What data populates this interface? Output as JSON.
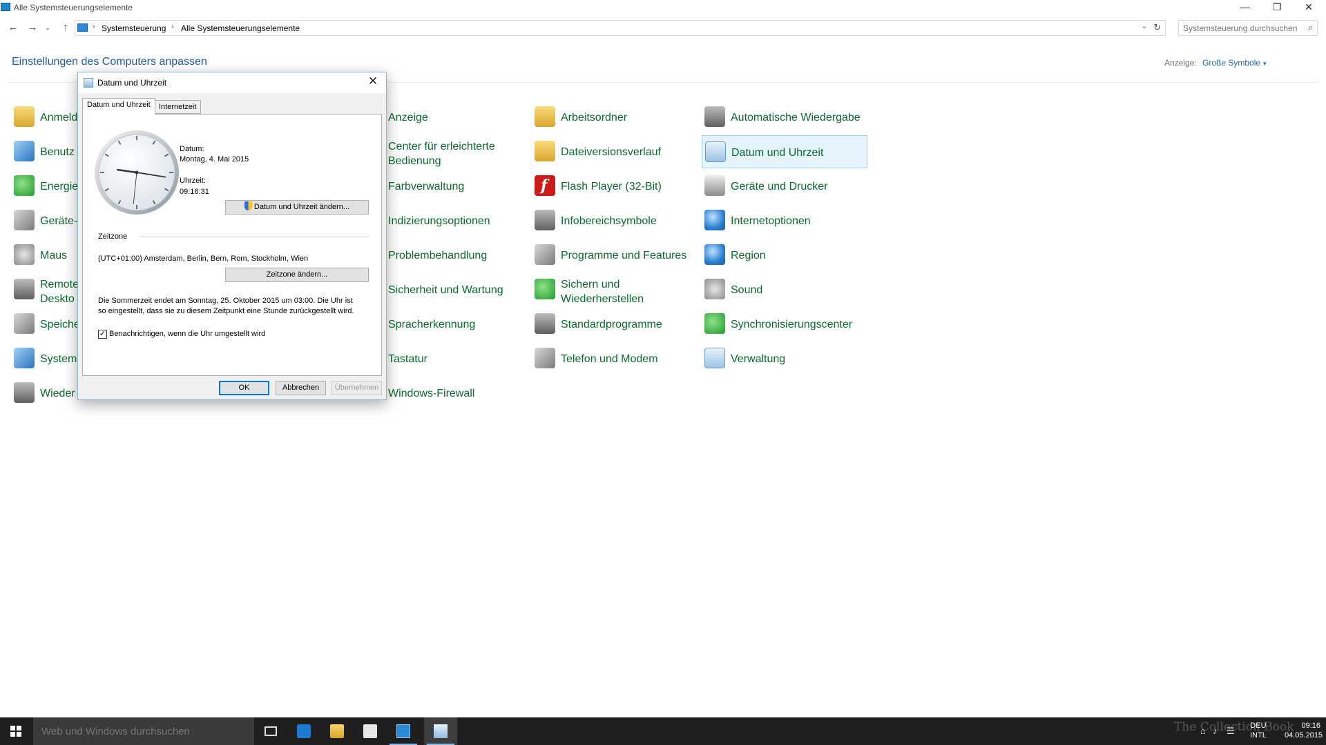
{
  "window": {
    "title": "Alle Systemsteuerungselemente",
    "min_icon": "—",
    "max_icon": "❐",
    "close_icon": "✕"
  },
  "nav": {
    "back_icon": "←",
    "forward_icon": "→",
    "recent_icon": "⌄",
    "up_icon": "↑",
    "breadcrumb_sep": "›",
    "breadcrumb": [
      "Systemsteuerung",
      "Alle Systemsteuerungselemente"
    ],
    "dropdown_icon": "⌄",
    "refresh_icon": "↻",
    "search_placeholder": "Systemsteuerung durchsuchen",
    "search_icon": "⌕"
  },
  "header": {
    "title": "Einstellungen des Computers anpassen",
    "view_label": "Anzeige:",
    "view_value": "Große Symbole",
    "view_caret": "▾"
  },
  "items": {
    "col1": [
      "Anmeld",
      "Benutz",
      "Energie",
      "Geräte-",
      "Maus",
      "Remote Deskto",
      "Speiche",
      "System",
      "Wieder"
    ],
    "col2": [
      "Anzeige",
      "Center für erleichterte Bedienung",
      "Farbverwaltung",
      "Indizierungsoptionen",
      "Problembehandlung",
      "Sicherheit und Wartung",
      "Spracherkennung",
      "Tastatur",
      "Windows-Firewall"
    ],
    "col3": [
      "Arbeitsordner",
      "Dateiversionsverlauf",
      "Flash Player (32-Bit)",
      "Infobereichsymbole",
      "Programme und Features",
      "Sichern und Wiederherstellen",
      "Standardprogramme",
      "Telefon und Modem"
    ],
    "col4": [
      "Automatische Wiedergabe",
      "Datum und Uhrzeit",
      "Geräte und Drucker",
      "Internetoptionen",
      "Region",
      "Sound",
      "Synchronisierungscenter",
      "Verwaltung"
    ]
  },
  "dialog": {
    "title": "Datum und Uhrzeit",
    "close_icon": "✕",
    "tabs": [
      "Datum und Uhrzeit",
      "Internetzeit"
    ],
    "date_label": "Datum:",
    "date_value": "Montag, 4. Mai 2015",
    "time_label": "Uhrzeit:",
    "time_value": "09:16:31",
    "change_datetime_button": "Datum und Uhrzeit ändern...",
    "timezone_label": "Zeitzone",
    "timezone_value": "(UTC+01:00) Amsterdam, Berlin, Bern, Rom, Stockholm, Wien",
    "change_timezone_button": "Zeitzone ändern...",
    "dst_line1": "Die Sommerzeit endet am Sonntag, 25. Oktober 2015 um 03:00. Die Uhr ist",
    "dst_line2": "so eingestellt, dass sie zu diesem Zeitpunkt eine Stunde zurückgestellt wird.",
    "notify_checked": true,
    "check_mark": "✓",
    "notify_label": "Benachrichtigen, wenn die Uhr umgestellt wird",
    "ok_button": "OK",
    "cancel_button": "Abbrechen",
    "apply_button": "Übernehmen"
  },
  "taskbar": {
    "search_placeholder": "Web und Windows durchsuchen",
    "language_top": "DEU",
    "language_bottom": "INTL",
    "time": "09:16",
    "date": "04.05.2015",
    "watermark": "The Collection Book"
  }
}
